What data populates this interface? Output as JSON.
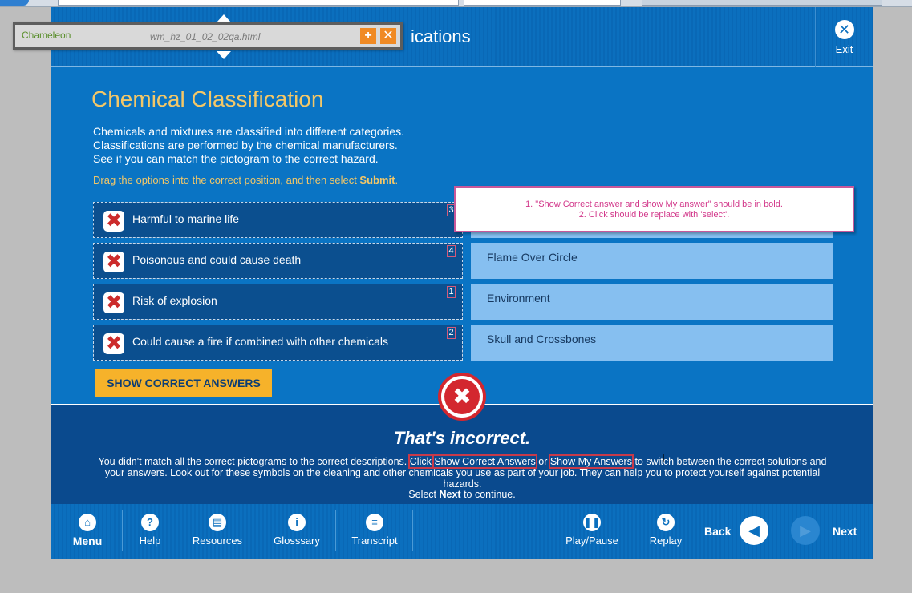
{
  "topbar": {
    "title": "ications",
    "exit_label": "Exit"
  },
  "overlay": {
    "logo": "Chameleon",
    "filename": "wm_hz_01_02_02qa.html"
  },
  "content": {
    "title": "Chemical Classification",
    "intro_lines": [
      "Chemicals and mixtures are classified into different categories.",
      "Classifications are performed by the chemical manufacturers.",
      "See if you can match the pictogram to the correct hazard."
    ],
    "instruction_prefix": "Drag the options into the correct position, and then select ",
    "instruction_bold": "Submit",
    "instruction_suffix": ".",
    "left_items": [
      {
        "text": "Harmful to marine life",
        "num": "3"
      },
      {
        "text": "Poisonous and could cause death",
        "num": "4"
      },
      {
        "text": "Risk of explosion",
        "num": "1"
      },
      {
        "text": "Could cause a fire if combined with other chemicals",
        "num": "2"
      }
    ],
    "right_items": [
      "",
      "Flame Over Circle",
      "Environment",
      "Skull and Crossbones"
    ],
    "note_line1": "1. \"Show Correct answer and show My answer\" should be in bold.",
    "note_line2": "2. Click should be replace with 'select'.",
    "show_button": "SHOW CORRECT ANSWERS"
  },
  "feedback": {
    "title": "That's incorrect.",
    "body_1": "You didn't match all the correct pictograms to the correct descriptions. ",
    "click": "Click",
    "show_correct": "Show Correct Answers",
    "or": " or ",
    "show_mine": "Show My Answers",
    "body_2": " to switch between the correct solutions and your answers.  Look out for these symbols on the cleaning and other chemicals you use as part of your job.  They can help you to protect yourself against potential hazards.",
    "select_prefix": "Select ",
    "select_bold": "Next",
    "select_suffix": " to continue."
  },
  "bottombar": {
    "menu": "Menu",
    "help": "Help",
    "resources": "Resources",
    "glossary": "Glosssary",
    "transcript": "Transcript",
    "play_pause": "Play/Pause",
    "replay": "Replay",
    "back": "Back",
    "next": "Next"
  }
}
